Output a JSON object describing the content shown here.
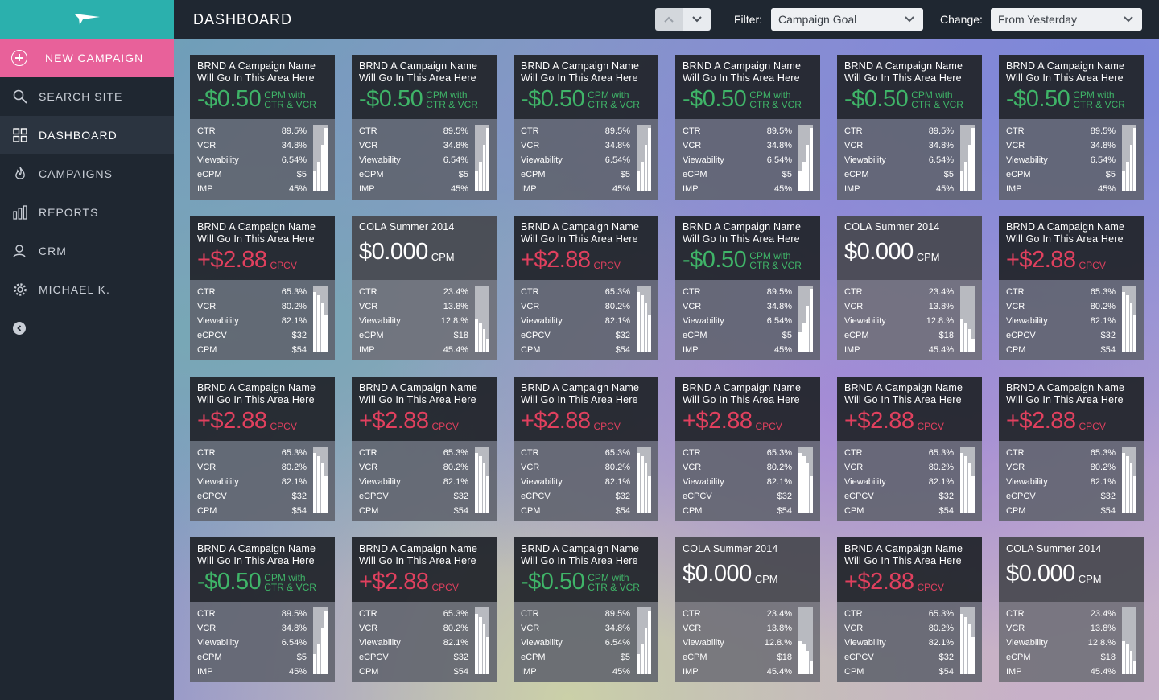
{
  "header": {
    "title": "DASHBOARD",
    "filter_label": "Filter:",
    "filter_value": "Campaign Goal",
    "change_label": "Change:",
    "change_value": "From Yesterday"
  },
  "sidebar": {
    "new_campaign": "NEW CAMPAIGN",
    "items": [
      {
        "label": "SEARCH SITE",
        "icon": "search-icon"
      },
      {
        "label": "DASHBOARD",
        "icon": "grid-icon"
      },
      {
        "label": "CAMPAIGNS",
        "icon": "flame-icon"
      },
      {
        "label": "REPORTS",
        "icon": "bar-chart-icon"
      },
      {
        "label": "CRM",
        "icon": "users-icon"
      },
      {
        "label": "MICHAEL K.",
        "icon": "gear-icon"
      }
    ]
  },
  "colors": {
    "logo_bg": "#2bb0ad",
    "new_campaign_bg": "#e8619a",
    "sidebar_bg": "#1f2731",
    "negative_value": "#3fb468",
    "positive_value": "#e0405e"
  },
  "templates": {
    "A": {
      "style": "dark",
      "name": "BRND A Campaign Name\nWill Go In This Area Here",
      "value": "-$0.50",
      "value_kind": "neg",
      "unit": "CPM with\nCTR & VCR",
      "metrics": [
        [
          "CTR",
          "89.5%"
        ],
        [
          "VCR",
          "34.8%"
        ],
        [
          "Viewability",
          "6.54%"
        ],
        [
          "eCPM",
          "$5"
        ],
        [
          "IMP",
          "45%"
        ]
      ],
      "bars": [
        0.3,
        0.45,
        0.7,
        0.95
      ]
    },
    "B": {
      "style": "dark",
      "name": "BRND A Campaign Name\nWill Go In This Area Here",
      "value": "+$2.88",
      "value_kind": "pos",
      "unit": "CPCV",
      "metrics": [
        [
          "CTR",
          "65.3%"
        ],
        [
          "VCR",
          "80.2%"
        ],
        [
          "Viewability",
          "82.1%"
        ],
        [
          "eCPCV",
          "$32"
        ],
        [
          "CPM",
          "$54"
        ]
      ],
      "bars": [
        0.9,
        0.85,
        0.75,
        0.55
      ]
    },
    "C": {
      "style": "gray",
      "name": "COLA Summer 2014",
      "value": "$0.000",
      "value_kind": "neutral",
      "unit": "CPM",
      "metrics": [
        [
          "CTR",
          "23.4%"
        ],
        [
          "VCR",
          "13.8%"
        ],
        [
          "Viewability",
          "12.8.%"
        ],
        [
          "eCPM",
          "$18"
        ],
        [
          "IMP",
          "45.4%"
        ]
      ],
      "bars": [
        0.5,
        0.45,
        0.35,
        0.2
      ]
    }
  },
  "grid": [
    "A",
    "A",
    "A",
    "A",
    "A",
    "A",
    "B",
    "C",
    "B",
    "A",
    "C",
    "B",
    "B",
    "B",
    "B",
    "B",
    "B",
    "B",
    "A",
    "B",
    "A",
    "C",
    "B",
    "C"
  ]
}
